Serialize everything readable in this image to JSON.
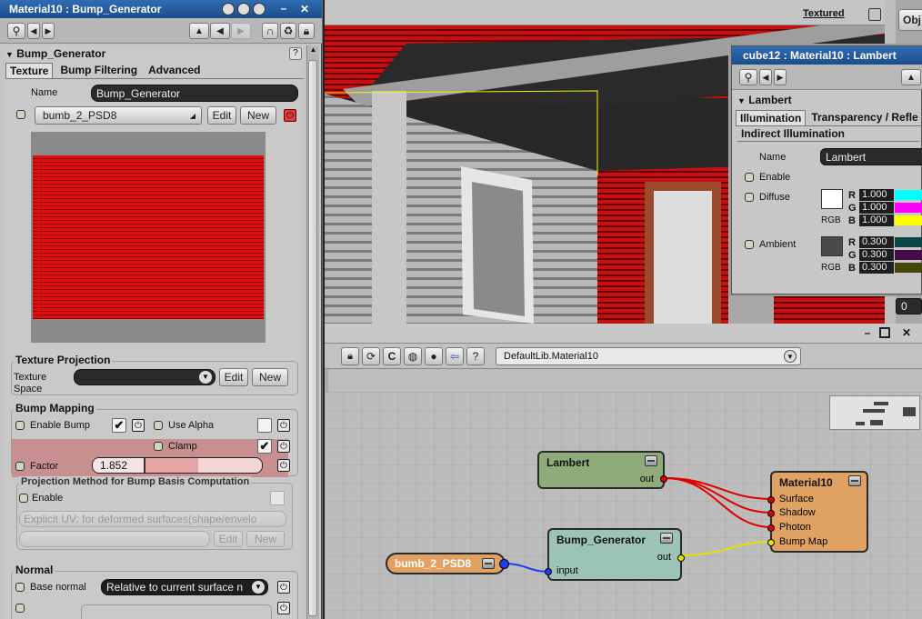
{
  "left_panel": {
    "title": "Material10 : Bump_Generator",
    "section": "Bump_Generator",
    "tabs": [
      "Texture",
      "Bump Filtering",
      "Advanced"
    ],
    "name_label": "Name",
    "name_value": "Bump_Generator",
    "texture_dropdown": "bumb_2_PSD8",
    "edit_label": "Edit",
    "new_label": "New",
    "texture_projection": {
      "title": "Texture Projection",
      "space_label_1": "Texture",
      "space_label_2": "Space",
      "edit_label": "Edit",
      "new_label": "New"
    },
    "bump_mapping": {
      "title": "Bump Mapping",
      "enable_bump": "Enable Bump",
      "use_alpha": "Use Alpha",
      "clamp": "Clamp",
      "factor_label": "Factor",
      "factor_value": "1.852",
      "factor_fraction": 0.45
    },
    "projection_method": {
      "title": "Projection Method for Bump Basis Computation",
      "enable": "Enable",
      "method": "Explicit UV: for deformed surfaces(shape/envelo",
      "edit_label": "Edit",
      "new_label": "New"
    },
    "normal": {
      "title": "Normal",
      "base_normal_label": "Base normal",
      "base_normal_value": "Relative to current surface n"
    }
  },
  "viewport": {
    "mode_label": "Textured",
    "right_tab": "Obj",
    "right_value": "0"
  },
  "lambert_panel": {
    "title": "cube12 : Material10 : Lambert",
    "section": "Lambert",
    "tabs": [
      "Illumination",
      "Transparency / Refle"
    ],
    "subtab": "Indirect Illumination",
    "name_label": "Name",
    "name_value": "Lambert",
    "enable_label": "Enable",
    "diffuse": {
      "label": "Diffuse",
      "mode": "RGB",
      "swatch": "#ffffff",
      "channels": [
        {
          "ch": "R",
          "value": "1.000",
          "color": "#00ffff"
        },
        {
          "ch": "G",
          "value": "1.000",
          "color": "#ff00ff"
        },
        {
          "ch": "B",
          "value": "1.000",
          "color": "#ffff00"
        }
      ]
    },
    "ambient": {
      "label": "Ambient",
      "mode": "RGB",
      "swatch": "#4a4a4a",
      "channels": [
        {
          "ch": "R",
          "value": "0.300",
          "color": "#0a4646"
        },
        {
          "ch": "G",
          "value": "0.300",
          "color": "#460a46"
        },
        {
          "ch": "B",
          "value": "0.300",
          "color": "#46460a"
        }
      ]
    }
  },
  "render_tree": {
    "path": "DefaultLib.Material10",
    "nodes": {
      "lambert": {
        "title": "Lambert",
        "out": "out",
        "color": "#8fab7a"
      },
      "material": {
        "title": "Material10",
        "ports": [
          "Surface",
          "Shadow",
          "Photon",
          "Bump Map"
        ],
        "color": "#e0a262"
      },
      "bump_generator": {
        "title": "Bump_Generator",
        "in": "input",
        "out": "out",
        "color": "#9cc3b7"
      },
      "image": {
        "title": "bumb_2_PSD8",
        "color": "#e0a262"
      }
    }
  }
}
